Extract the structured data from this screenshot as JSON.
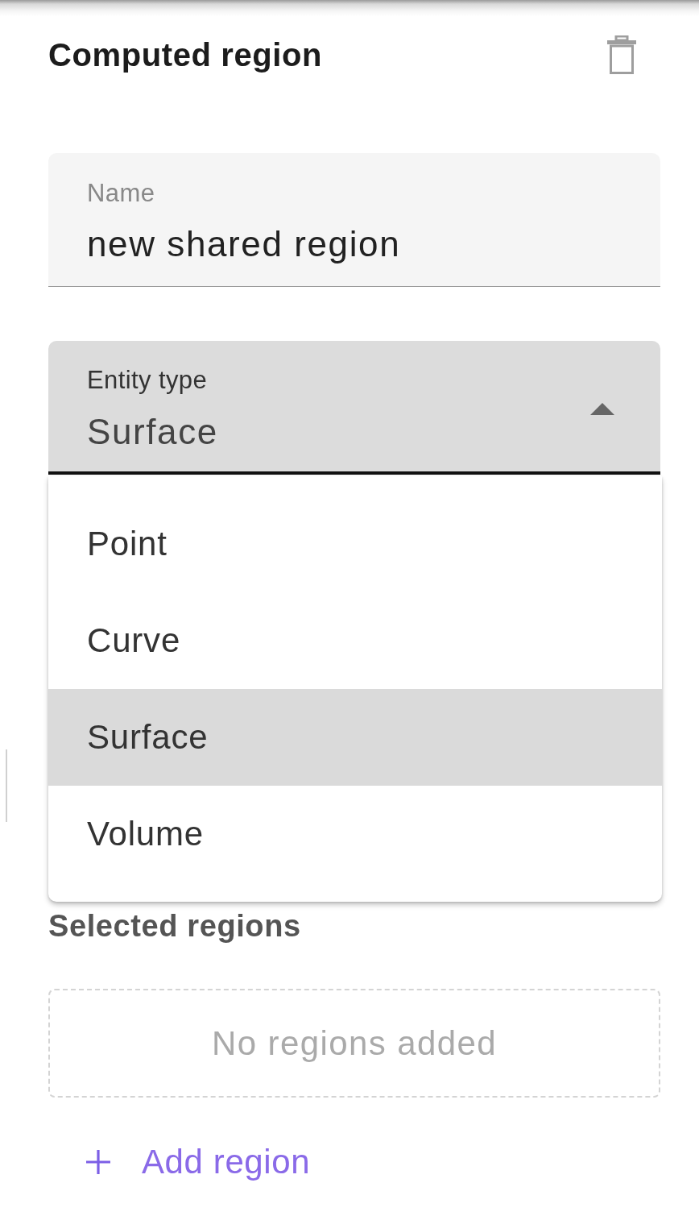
{
  "header": {
    "title": "Computed region"
  },
  "name_field": {
    "label": "Name",
    "value": "new shared region"
  },
  "entity_type_select": {
    "label": "Entity type",
    "value": "Surface",
    "expanded": true,
    "options": [
      {
        "label": "Point",
        "selected": false
      },
      {
        "label": "Curve",
        "selected": false
      },
      {
        "label": "Surface",
        "selected": true
      },
      {
        "label": "Volume",
        "selected": false
      }
    ]
  },
  "selected_regions": {
    "title": "Selected regions",
    "empty_text": "No regions added"
  },
  "add_region_button": {
    "label": "Add region"
  }
}
